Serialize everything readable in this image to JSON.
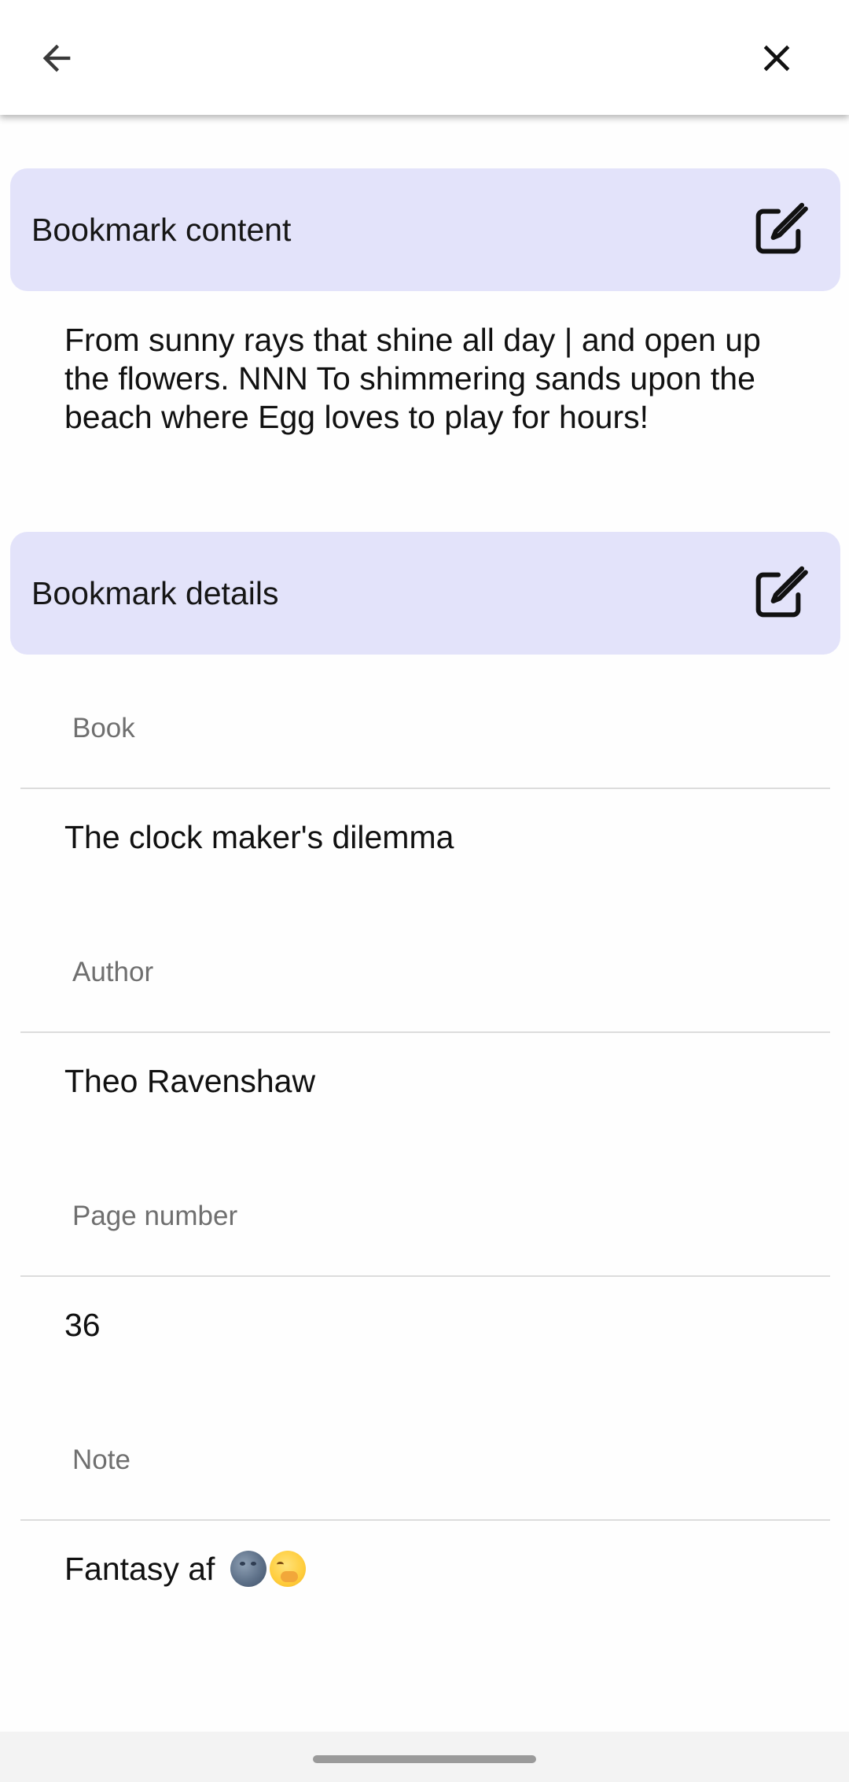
{
  "topbar": {
    "back_icon": "arrow-left-icon",
    "close_icon": "close-icon"
  },
  "content_section": {
    "title": "Bookmark content",
    "edit_icon": "edit-icon",
    "text": "From sunny rays that shine all day | and open up the flowers. NNN To shimmering sands upon the beach where Egg loves to play for hours!"
  },
  "details_section": {
    "title": "Bookmark details",
    "edit_icon": "edit-icon",
    "fields": {
      "book": {
        "label": "Book",
        "value": "The clock maker's dilemma"
      },
      "author": {
        "label": "Author",
        "value": "Theo Ravenshaw"
      },
      "page": {
        "label": "Page number",
        "value": "36"
      },
      "note": {
        "label": "Note",
        "value": "Fantasy af",
        "emojis": [
          "new-moon-face-emoji",
          "face-with-hand-over-mouth-emoji"
        ]
      }
    }
  },
  "colors": {
    "section_header_bg": "#e3e3fa",
    "label_gray": "#6f6f6f",
    "divider": "#dcdcdc"
  }
}
